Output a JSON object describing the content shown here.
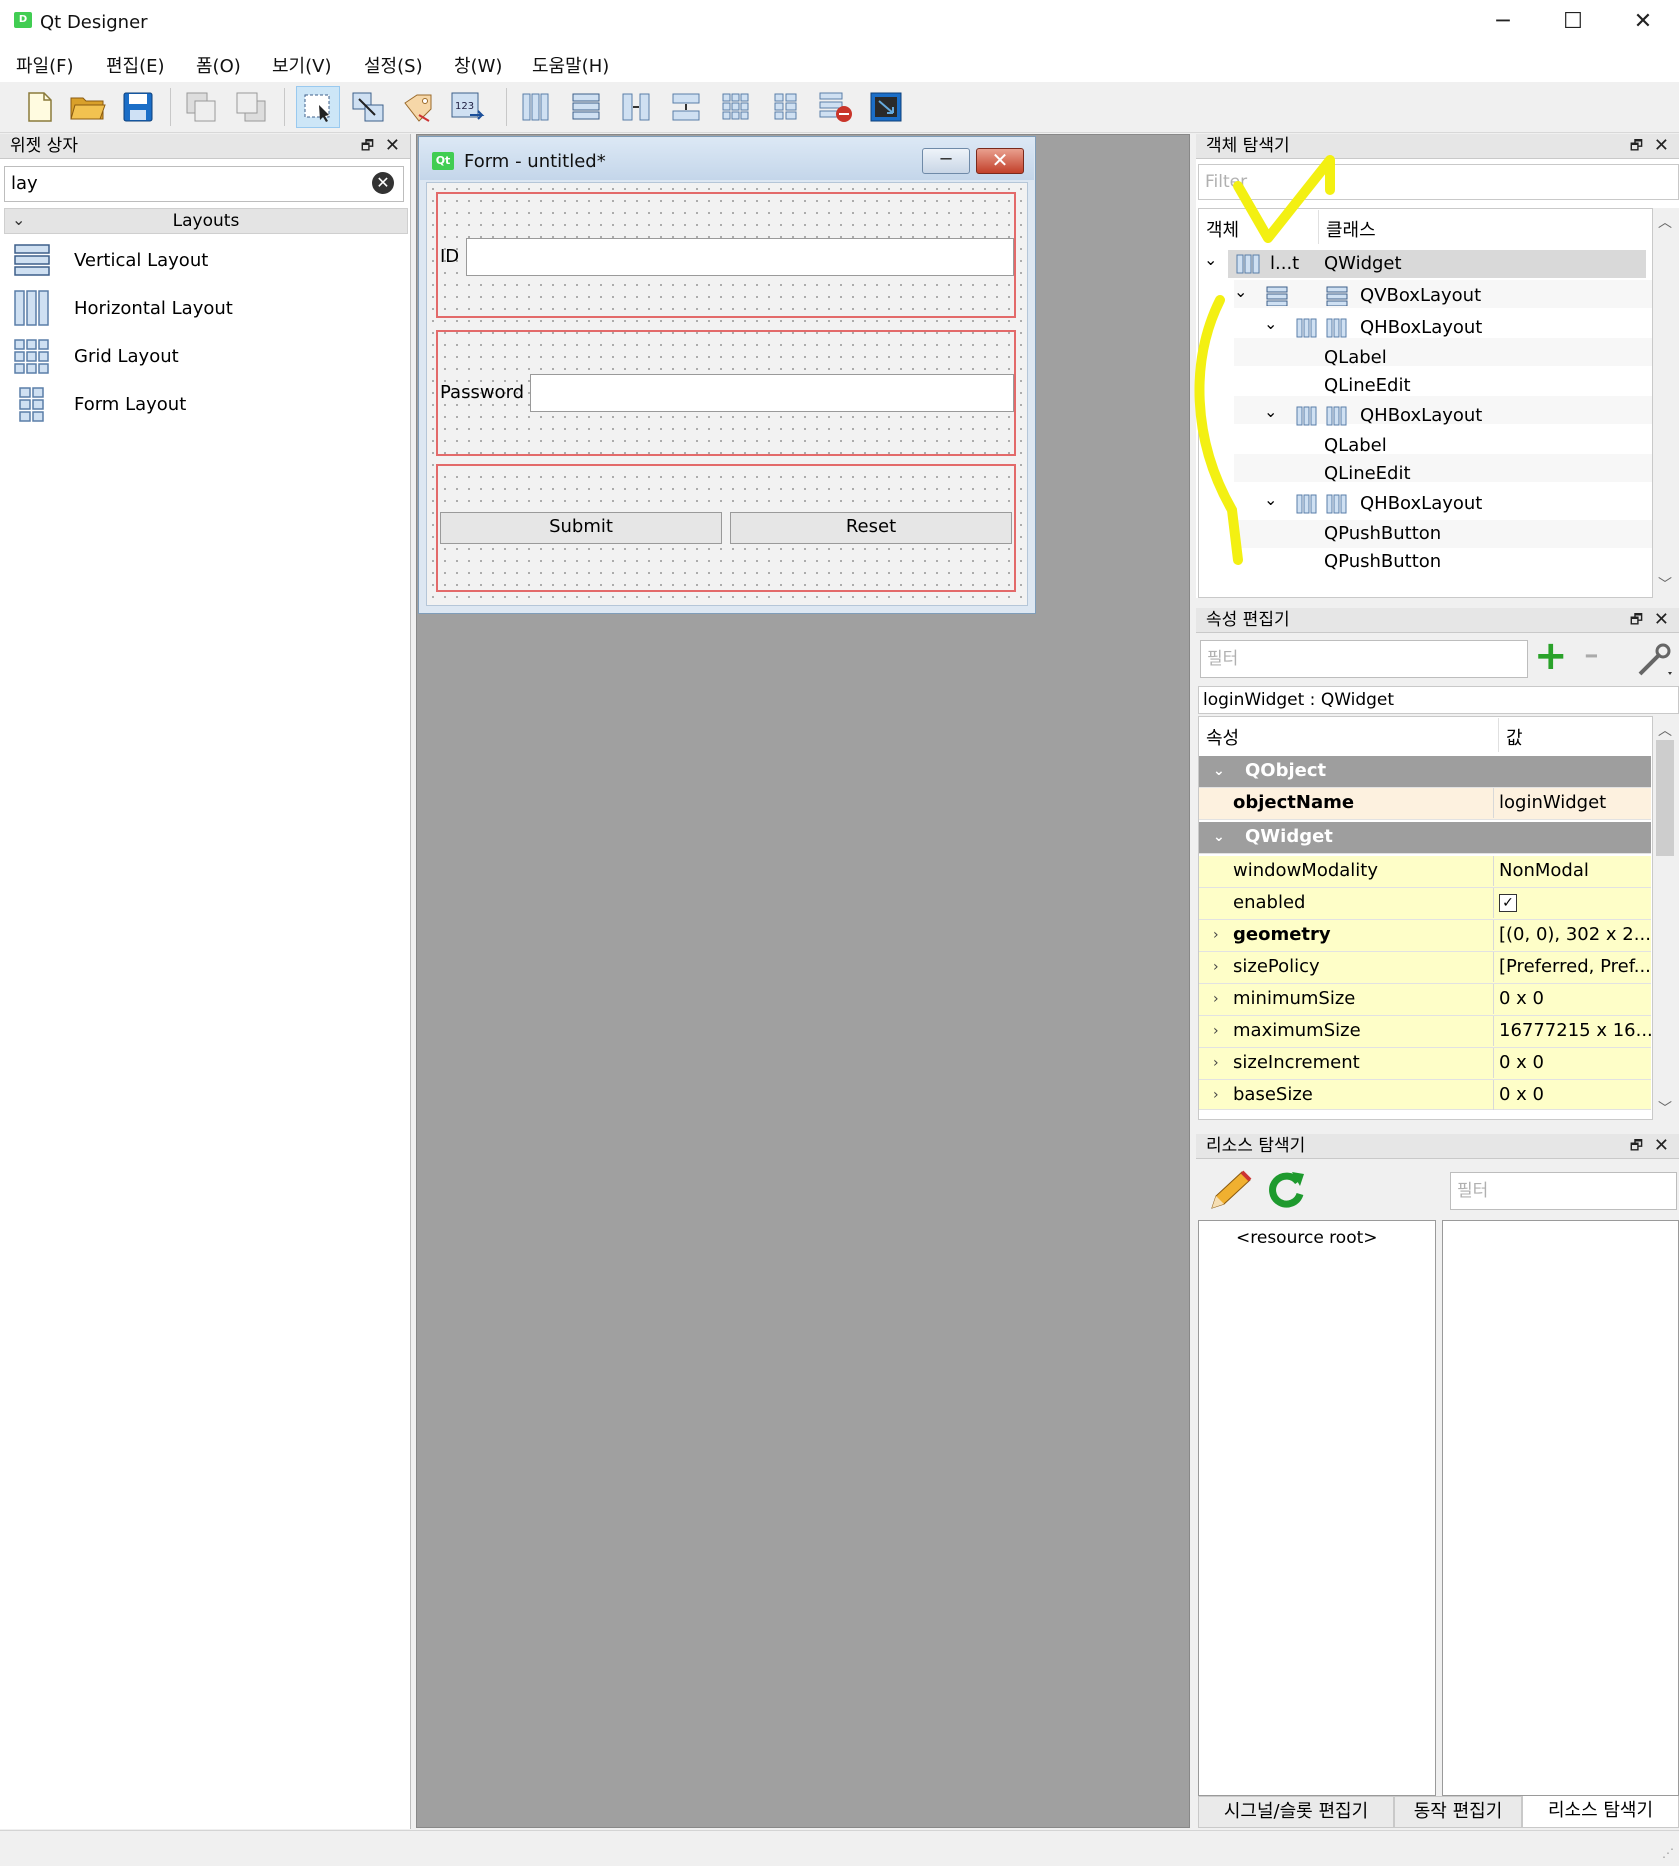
{
  "window": {
    "title": "Qt Designer",
    "logo_text": "D",
    "controls": {
      "minimize": "─",
      "maximize": "☐",
      "close": "✕"
    }
  },
  "menu": [
    "파일(F)",
    "편집(E)",
    "폼(O)",
    "보기(V)",
    "설정(S)",
    "창(W)",
    "도움말(H)"
  ],
  "toolbar": {
    "icons": [
      "new-form-icon",
      "open-form-icon",
      "save-form-icon",
      "bring-front-icon",
      "send-back-icon",
      "edit-widgets-icon",
      "edit-signals-slots-icon",
      "edit-buddies-icon",
      "edit-tab-order-icon",
      "layout-horizontal-icon",
      "layout-vertical-icon",
      "layout-h-splitter-icon",
      "layout-v-splitter-icon",
      "layout-grid-icon",
      "layout-form-icon",
      "break-layout-icon",
      "adjust-size-icon"
    ]
  },
  "widget_box": {
    "title": "위젯 상자",
    "float_glyph": "🗗",
    "close_glyph": "✕",
    "search_value": "lay",
    "clear_glyph": "✕",
    "category": "Layouts",
    "items": [
      {
        "label": "Vertical Layout",
        "icon": "vertical-layout-icon"
      },
      {
        "label": "Horizontal Layout",
        "icon": "horizontal-layout-icon"
      },
      {
        "label": "Grid Layout",
        "icon": "grid-layout-icon"
      },
      {
        "label": "Form Layout",
        "icon": "form-layout-icon"
      }
    ]
  },
  "form": {
    "title": "Form - untitled*",
    "qt_badge": "Qt",
    "minimize": "─",
    "close": "✕",
    "id_label": "ID",
    "password_label": "Password",
    "submit_label": "Submit",
    "reset_label": "Reset"
  },
  "object_inspector": {
    "title": "객체 탐색기",
    "float_glyph": "🗗",
    "close_glyph": "✕",
    "filter_placeholder": "Filter",
    "col_object": "객체",
    "col_class": "클래스",
    "rows": [
      {
        "object": "l...t",
        "class": "QWidget"
      },
      {
        "class": "QVBoxLayout"
      },
      {
        "class": "QHBoxLayout"
      },
      {
        "class": "QLabel"
      },
      {
        "class": "QLineEdit"
      },
      {
        "class": "QHBoxLayout"
      },
      {
        "class": "QLabel"
      },
      {
        "class": "QLineEdit"
      },
      {
        "class": "QHBoxLayout"
      },
      {
        "class": "QPushButton"
      },
      {
        "class": "QPushButton"
      }
    ]
  },
  "property_editor": {
    "title": "속성 편집기",
    "float_glyph": "🗗",
    "close_glyph": "✕",
    "filter_placeholder": "필터",
    "add_glyph": "+",
    "remove_glyph": "━",
    "context": "loginWidget : QWidget",
    "col_property": "속성",
    "col_value": "값",
    "rows": [
      {
        "name": "QObject",
        "group": true
      },
      {
        "name": "objectName",
        "value": "loginWidget"
      },
      {
        "name": "QWidget",
        "group": true
      },
      {
        "name": "windowModality",
        "value": "NonModal"
      },
      {
        "name": "enabled",
        "value": "✓"
      },
      {
        "name": "geometry",
        "value": "[(0, 0), 302 x 2..."
      },
      {
        "name": "sizePolicy",
        "value": "[Preferred, Pref..."
      },
      {
        "name": "minimumSize",
        "value": "0 x 0"
      },
      {
        "name": "maximumSize",
        "value": "16777215 x 16..."
      },
      {
        "name": "sizeIncrement",
        "value": "0 x 0"
      },
      {
        "name": "baseSize",
        "value": "0 x 0"
      }
    ],
    "colors": {
      "highlight_row": "#fdf1df",
      "yellow_row": "#fefec8",
      "group": "#9e9e9e"
    }
  },
  "resource_browser": {
    "title": "리소스 탐색기",
    "float_glyph": "🗗",
    "close_glyph": "✕",
    "filter_placeholder": "필터",
    "root_label": "<resource root>",
    "edit_icon": "pencil-icon",
    "reload_icon": "reload-icon"
  },
  "bottom_tabs": [
    "시그널/슬롯 편집기",
    "동작 편집기",
    "리소스 탐색기"
  ],
  "scroll": {
    "up": "︿",
    "down": "﹀"
  }
}
